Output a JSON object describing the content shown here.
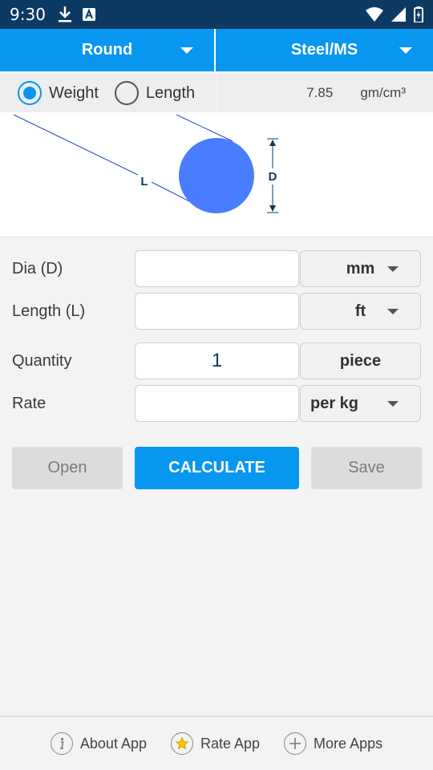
{
  "status_bar": {
    "time": "9:30"
  },
  "shape_dropdown": {
    "selected": "Round"
  },
  "material_dropdown": {
    "selected": "Steel/MS"
  },
  "mode": {
    "weight_label": "Weight",
    "length_label": "Length",
    "selected": "Weight"
  },
  "density": {
    "value": "7.85",
    "unit": "gm/cm³"
  },
  "diagram": {
    "length_label": "L",
    "dia_label": "D",
    "circle_color": "#4a7cff"
  },
  "form": {
    "dia": {
      "label": "Dia (D)",
      "value": "",
      "unit": "mm"
    },
    "length": {
      "label": "Length (L)",
      "value": "",
      "unit": "ft"
    },
    "quantity": {
      "label": "Quantity",
      "value": "1",
      "unit": "piece"
    },
    "rate": {
      "label": "Rate",
      "value": "",
      "unit": "per kg"
    }
  },
  "actions": {
    "open_label": "Open",
    "calculate_label": "CALCULATE",
    "save_label": "Save"
  },
  "footer": {
    "about_label": "About App",
    "rate_label": "Rate App",
    "more_label": "More Apps"
  },
  "colors": {
    "primary": "#0897f0",
    "status_bar": "#0d3a62"
  }
}
